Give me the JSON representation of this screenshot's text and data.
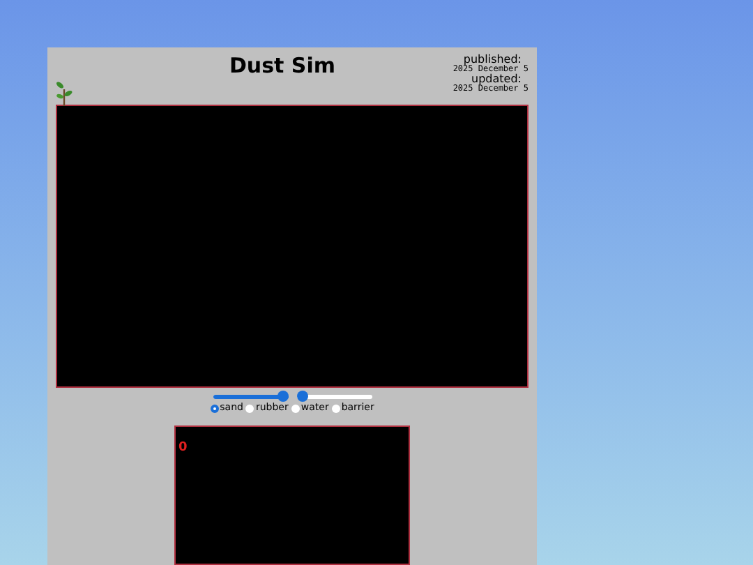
{
  "title": "Dust Sim",
  "meta": [
    {
      "label": "published:",
      "date": "2025 December 5"
    },
    {
      "label": "updated:",
      "date": "2025 December 5"
    }
  ],
  "sliders": [
    {
      "level": 1.0
    },
    {
      "level": 0.0
    }
  ],
  "materials": [
    {
      "label": "sand",
      "selected": true
    },
    {
      "label": "rubber",
      "selected": false
    },
    {
      "label": "water",
      "selected": false
    },
    {
      "label": "barrier",
      "selected": false
    }
  ],
  "counter": "0"
}
